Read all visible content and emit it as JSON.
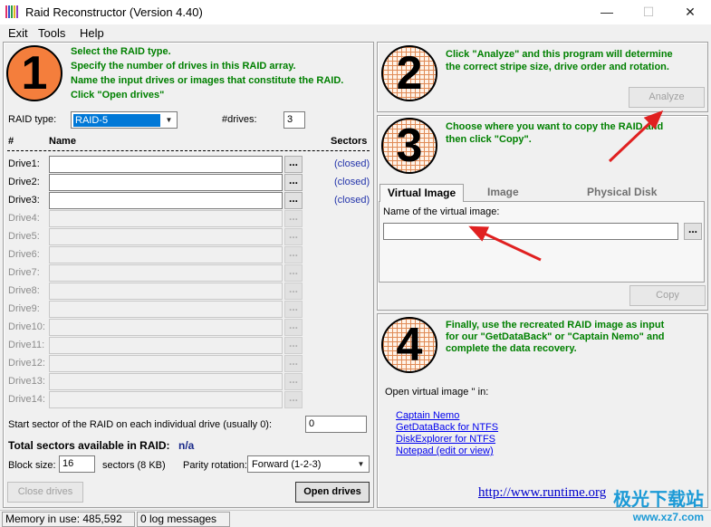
{
  "window": {
    "title": "Raid Reconstructor (Version 4.40)"
  },
  "menu": [
    "Exit",
    "Tools",
    "Help"
  ],
  "step1": {
    "number": "1",
    "lines": [
      "Select the RAID type.",
      "Specify the number of drives in this RAID array.",
      "Name the input drives or images that constitute the RAID.",
      "Click \"Open drives\""
    ],
    "raid_type_label": "RAID type:",
    "raid_type_value": "RAID-5",
    "drives_label": "#drives:",
    "drives_value": "3",
    "col_hash": "#",
    "col_name": "Name",
    "col_sectors": "Sectors",
    "drives": [
      {
        "label": "Drive1:",
        "status": "(closed)"
      },
      {
        "label": "Drive2:",
        "status": "(closed)"
      },
      {
        "label": "Drive3:",
        "status": "(closed)"
      },
      {
        "label": "Drive4:",
        "status": ""
      },
      {
        "label": "Drive5:",
        "status": ""
      },
      {
        "label": "Drive6:",
        "status": ""
      },
      {
        "label": "Drive7:",
        "status": ""
      },
      {
        "label": "Drive8:",
        "status": ""
      },
      {
        "label": "Drive9:",
        "status": ""
      },
      {
        "label": "Drive10:",
        "status": ""
      },
      {
        "label": "Drive11:",
        "status": ""
      },
      {
        "label": "Drive12:",
        "status": ""
      },
      {
        "label": "Drive13:",
        "status": ""
      },
      {
        "label": "Drive14:",
        "status": ""
      }
    ],
    "browse_label": "...",
    "start_sector_label": "Start sector of the RAID on each individual drive (usually 0):",
    "start_sector_value": "0",
    "total_sectors_label": "Total sectors available in RAID:",
    "total_sectors_value": "n/a",
    "block_size_label": "Block size:",
    "block_size_value": "16",
    "block_size_unit": "sectors (8 KB)",
    "parity_label": "Parity rotation:",
    "parity_value": "Forward (1-2-3)",
    "close_drives": "Close drives",
    "open_drives": "Open drives"
  },
  "step2": {
    "number": "2",
    "lines": [
      "Click \"Analyze\" and this program will determine",
      "the correct stripe size, drive order and rotation."
    ],
    "analyze": "Analyze"
  },
  "step3": {
    "number": "3",
    "lines": [
      "Choose where you want to copy the RAID and",
      "then click \"Copy\"."
    ],
    "tabs": [
      "Virtual Image",
      "Image",
      "Physical Disk"
    ],
    "name_label": "Name of the virtual image:",
    "name_value": "",
    "browse_label": "...",
    "copy": "Copy"
  },
  "step4": {
    "number": "4",
    "lines": [
      "Finally, use the recreated RAID image as input",
      "for our \"GetDataBack\" or \"Captain Nemo\" and",
      "complete the data recovery."
    ],
    "open_label": "Open virtual image '' in:",
    "links": [
      "Captain Nemo",
      "GetDataBack for NTFS",
      "DiskExplorer for NTFS",
      "Notepad (edit or view)"
    ],
    "url": "http://www.runtime.org"
  },
  "status": {
    "memory": "Memory in use: 485,592",
    "log": "0 log messages"
  },
  "watermark": {
    "logo": "极光下载站",
    "url": "www.xz7.com"
  },
  "colors": {
    "accent_orange": "#f47e3c",
    "instruction_green": "#008000",
    "arrow_red": "#e02020",
    "link_blue": "#0000ee"
  }
}
